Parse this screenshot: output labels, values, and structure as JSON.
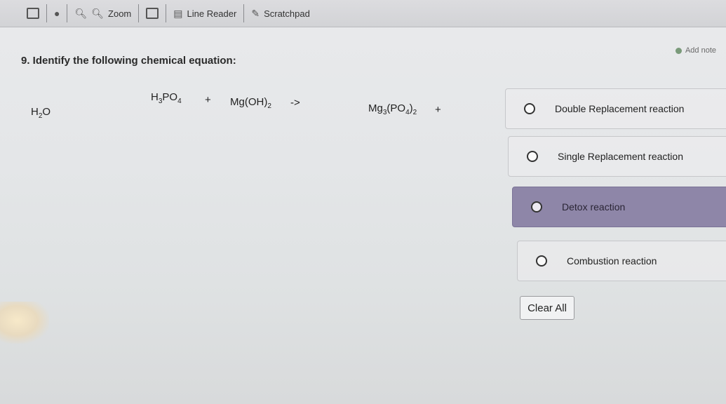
{
  "toolbar": {
    "zoom_label": "Zoom",
    "line_reader_label": "Line Reader",
    "scratchpad_label": "Scratchpad",
    "icons": [
      "calculator-icon",
      "palette-icon",
      "zoom-out-icon",
      "zoom-in-icon",
      "screen-icon",
      "line-reader-icon",
      "scratchpad-icon"
    ]
  },
  "add_note_label": "Add note",
  "question": {
    "text": "9. Identify the following chemical equation:",
    "equation": {
      "reactant1": {
        "a": "H",
        "s1": "3",
        "b": "PO",
        "s2": "4"
      },
      "plus1": "+",
      "reactant2": {
        "a": "Mg(OH)",
        "s1": "2"
      },
      "arrow": "->",
      "product1": {
        "a": "Mg",
        "s1": "3",
        "b": "(PO",
        "s2": "4",
        "c": ")",
        "s3": "2"
      },
      "plus2": "+",
      "product2": {
        "a": "H",
        "s1": "2",
        "b": "O"
      }
    }
  },
  "options": [
    {
      "label": "Double Replacement reaction",
      "selected": false
    },
    {
      "label": "Single Replacement reaction",
      "selected": false
    },
    {
      "label": "Detox reaction",
      "selected": true
    },
    {
      "label": "Combustion reaction",
      "selected": false
    }
  ],
  "clear_all_label": "Clear All",
  "colors": {
    "selected_option": "#8e86a8"
  }
}
